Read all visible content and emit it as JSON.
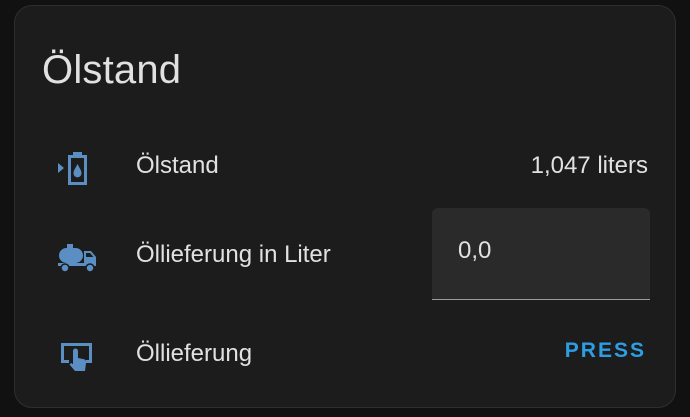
{
  "card": {
    "title": "Ölstand"
  },
  "rows": [
    {
      "icon": "oil-tank-icon",
      "label": "Ölstand",
      "value": "1,047 liters"
    },
    {
      "icon": "tanker-truck-icon",
      "label": "Öllieferung in Liter",
      "input_value": "0,0"
    },
    {
      "icon": "gesture-tap-button-icon",
      "label": "Öllieferung",
      "button_label": "PRESS"
    }
  ],
  "colors": {
    "background": "#111111",
    "card": "#1c1c1c",
    "text": "#e1e1e1",
    "icon": "#5b8fc4",
    "accent": "#2d9ee3",
    "input_bg": "#2a2a2a"
  }
}
